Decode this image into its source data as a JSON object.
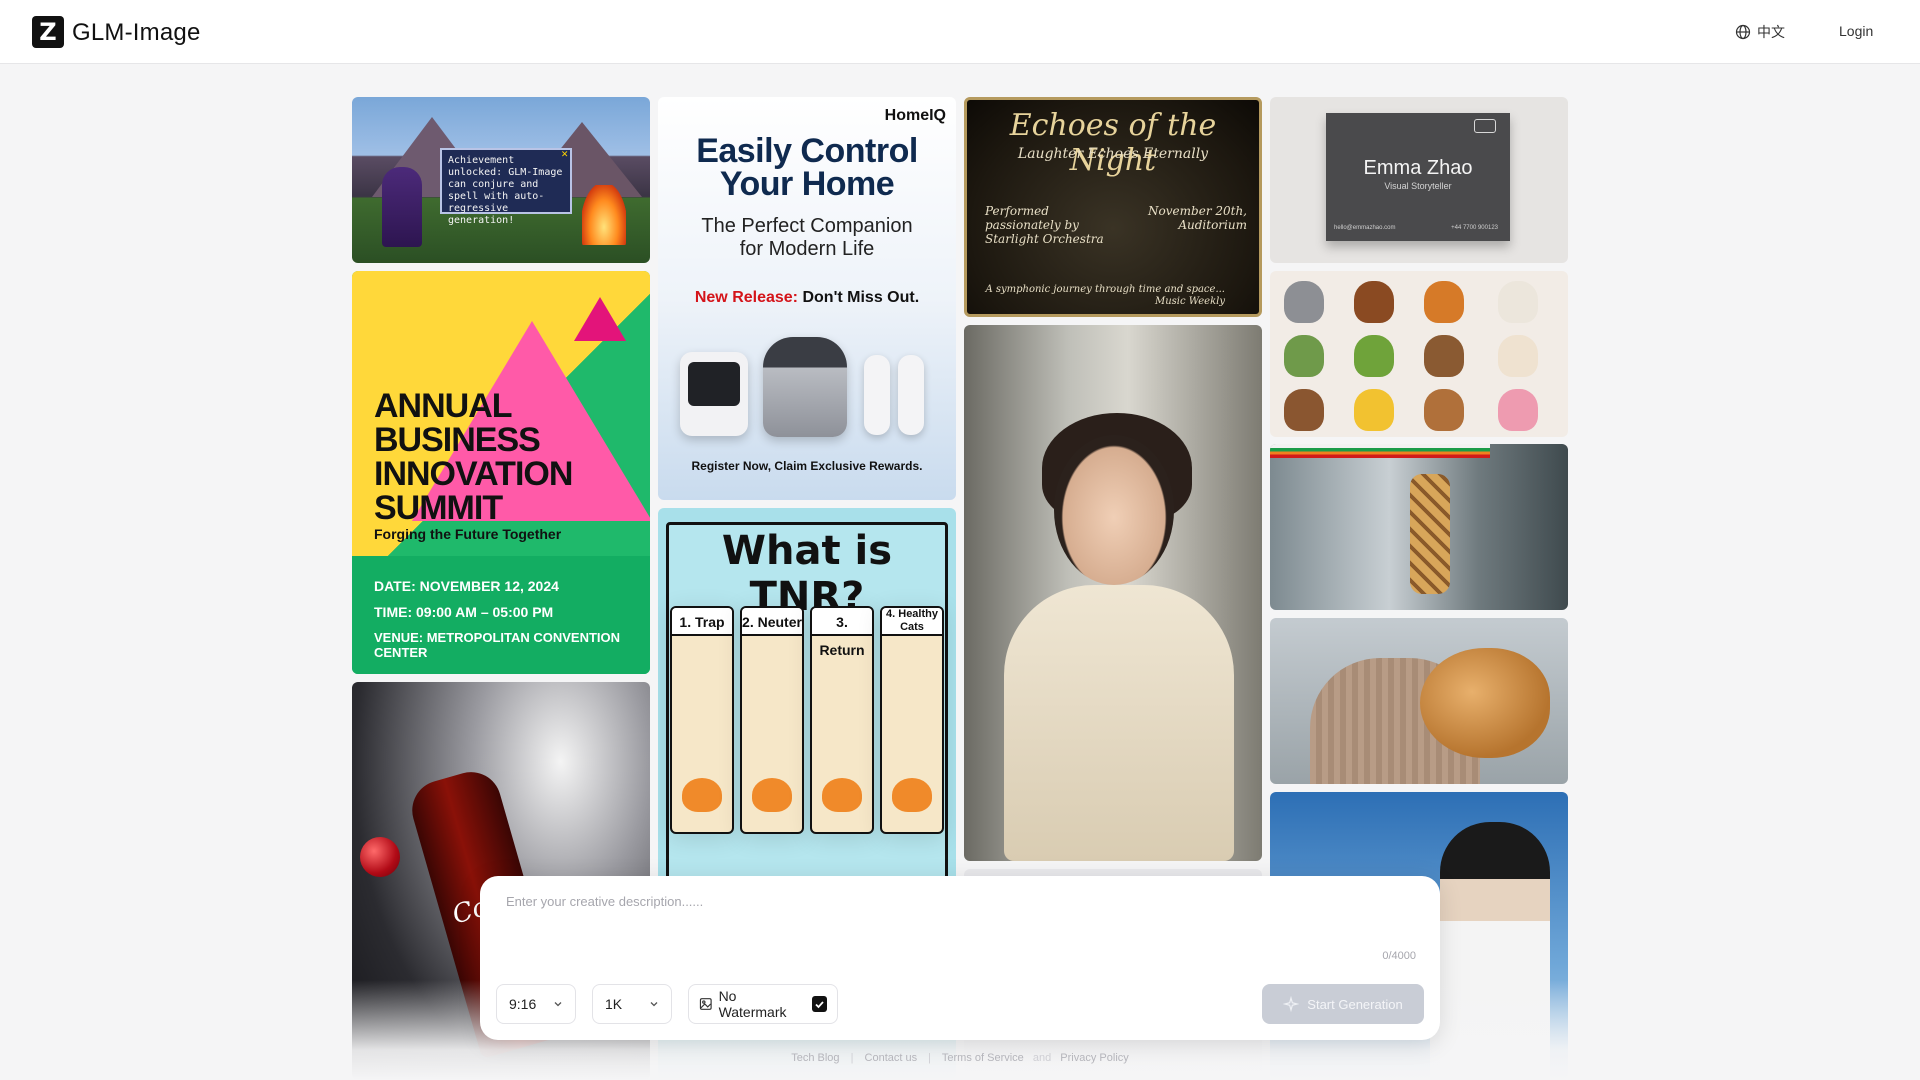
{
  "header": {
    "logo_letter": "Z",
    "brand": "GLM-Image",
    "language_label": "中文",
    "login_label": "Login"
  },
  "gallery": {
    "pixel_art": {
      "dialog_text": "Achievement unlocked: GLM-Image can conjure and spell with auto-regressive generation!"
    },
    "summit": {
      "title_line1": "ANNUAL",
      "title_line2": "BUSINESS",
      "title_line3": "INNOVATION",
      "title_line4": "SUMMIT",
      "subtitle": "Forging the Future Together",
      "date": "DATE: NOVEMBER 12, 2024",
      "time": "TIME: 09:00 AM – 05:00 PM",
      "venue": "VENUE: METROPOLITAN CONVENTION CENTER"
    },
    "homeiq": {
      "brand": "HomeIQ",
      "headline_line1": "Easily Control",
      "headline_line2": "Your Home",
      "sub_line1": "The Perfect Companion",
      "sub_line2": "for Modern Life",
      "release_red": "New Release:",
      "release_rest": " Don't Miss Out.",
      "cta": "Register Now, Claim Exclusive Rewards."
    },
    "tnr": {
      "title": "What is TNR?",
      "panels": [
        "1. Trap",
        "2. Neuter",
        "3. Return",
        "4. Healthy Cats"
      ]
    },
    "echoes": {
      "title": "Echoes of the Night",
      "subtitle": "Laughter Echoes Eternally",
      "left_line1": "Performed",
      "left_line2": "passionately by",
      "left_line3": "Starlight Orchestra",
      "right_line1": "November 20th,",
      "right_line2": "Auditorium",
      "bottom_line1": "A symphonic journey through time and space...",
      "bottom_line2": "Music Weekly"
    },
    "card": {
      "name": "Emma Zhao",
      "role": "Visual Storyteller",
      "email": "hello@emmazhao.com",
      "phone": "+44 7700 900123"
    },
    "coke": {
      "label": "Coca"
    }
  },
  "prompt_panel": {
    "placeholder": "Enter your creative description......",
    "char_count": "0/4000",
    "aspect_ratio": "9:16",
    "resolution": "1K",
    "watermark_label": "No Watermark",
    "watermark_checked": true,
    "generate_label": "Start Generation"
  },
  "footer": {
    "tech_blog": "Tech Blog",
    "contact": "Contact us",
    "terms": "Terms of Service",
    "and": "and",
    "privacy": "Privacy Policy"
  },
  "colors": {
    "accent_dark": "#111111",
    "generate_disabled": "#c9cdd6",
    "background": "#f5f5f6"
  },
  "icons": {
    "logo": "z-logo-icon",
    "language": "globe-icon",
    "dropdown": "chevron-down-icon",
    "watermark": "image-icon",
    "checkbox": "checkmark-icon",
    "generate": "sparkle-icon"
  }
}
